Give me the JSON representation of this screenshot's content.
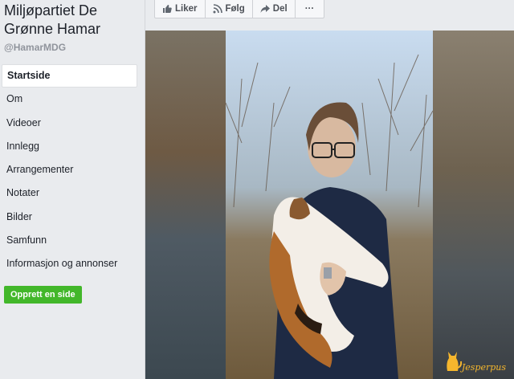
{
  "page": {
    "name": "Miljøpartiet De Grønne Hamar",
    "handle": "@HamarMDG"
  },
  "nav": {
    "items": [
      {
        "label": "Startside"
      },
      {
        "label": "Om"
      },
      {
        "label": "Videoer"
      },
      {
        "label": "Innlegg"
      },
      {
        "label": "Arrangementer"
      },
      {
        "label": "Notater"
      },
      {
        "label": "Bilder"
      },
      {
        "label": "Samfunn"
      },
      {
        "label": "Informasjon og annonser"
      }
    ],
    "active": "Startside"
  },
  "create_page_label": "Opprett en side",
  "actions": {
    "like": "Liker",
    "follow": "Følg",
    "share": "Del",
    "more": "···"
  },
  "video": {
    "watermark": "Jesperpus"
  },
  "colors": {
    "green_button": "#42b72a",
    "sidebar_bg": "#e9ebee",
    "watermark": "#f5b62d"
  }
}
